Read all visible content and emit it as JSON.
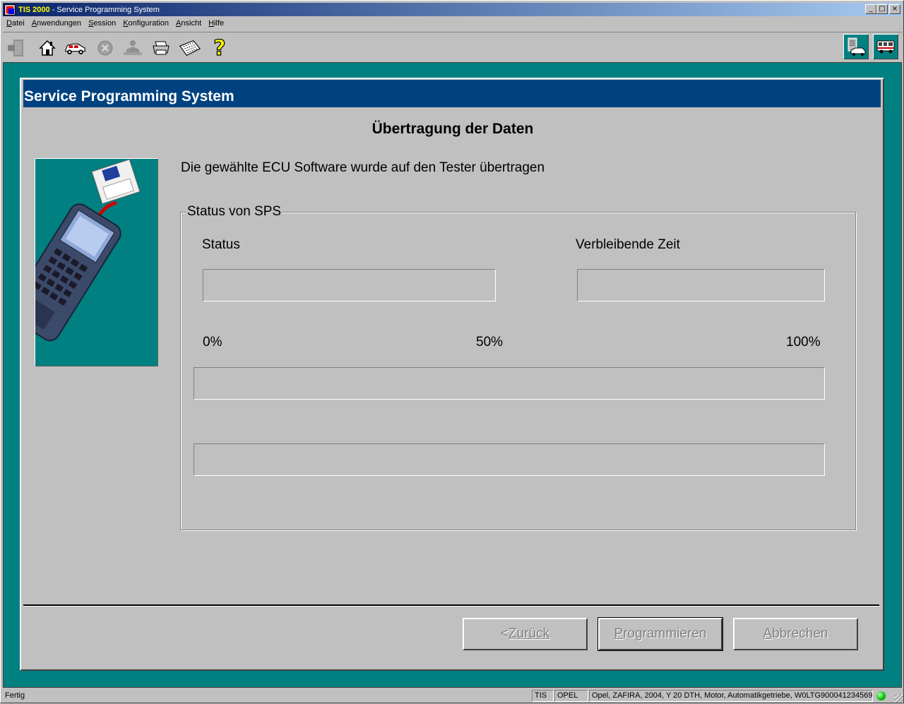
{
  "window": {
    "title_brand": "TIS 2000",
    "title_rest": " - Service Programming System",
    "minimize": "_",
    "maximize": "□",
    "close": "×"
  },
  "menu": [
    {
      "label_u": "D",
      "label_rest": "atei"
    },
    {
      "label_u": "A",
      "label_rest": "nwendungen"
    },
    {
      "label_u": "S",
      "label_rest": "ession"
    },
    {
      "label_u": "K",
      "label_rest": "onfiguration"
    },
    {
      "label_u": "A",
      "label_rest": "nsicht"
    },
    {
      "label_u": "H",
      "label_rest": "ilfe"
    }
  ],
  "toolbar": {
    "icons": [
      "exit-icon",
      "home-icon",
      "vehicle-icon",
      "stop-icon",
      "user-icon",
      "print-icon",
      "keyboard-icon",
      "help-icon"
    ],
    "right_icons": [
      "vehicle-data-icon",
      "bus-icon"
    ]
  },
  "panel": {
    "header": "Service Programming System",
    "title": "Übertragung der Daten",
    "message": "Die gewählte ECU Software wurde auf den Tester übertragen",
    "group_label": "Status von SPS",
    "status_label": "Status",
    "remaining_label": "Verbleibende Zeit",
    "pct_0": "0%",
    "pct_50": "50%",
    "pct_100": "100%",
    "progress": 0
  },
  "buttons": {
    "back": {
      "u": "<",
      "rest": " Zurück"
    },
    "program": {
      "u": "P",
      "rest": "rogrammieren"
    },
    "cancel": {
      "u": "A",
      "rest": "bbrechen"
    }
  },
  "statusbar": {
    "state": "Fertig",
    "app": "TIS",
    "brand": "OPEL",
    "vehicle": "Opel, ZAFIRA, 2004, Y 20 DTH, Motor, Automatikgetriebe, W0LTG900041234569"
  }
}
